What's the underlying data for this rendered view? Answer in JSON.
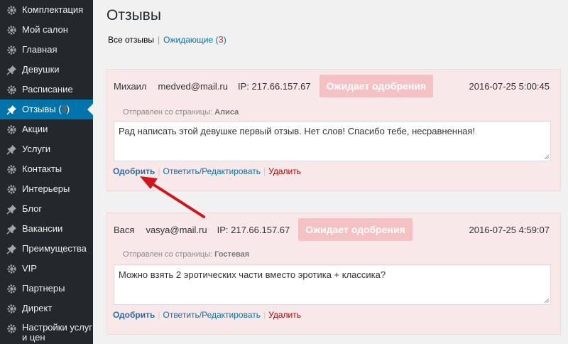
{
  "sidebar": {
    "items": [
      {
        "label": "Комплектация",
        "icon": "gear-icon"
      },
      {
        "label": "Мой салон",
        "icon": "gear-icon"
      },
      {
        "label": "Главная",
        "icon": "gear-icon"
      },
      {
        "label": "Девушки",
        "icon": "pin-icon"
      },
      {
        "label": "Расписание",
        "icon": "gear-icon"
      },
      {
        "label": "Отзывы (",
        "badge": "3",
        "suffix": ")",
        "icon": "pin-icon",
        "active": true
      },
      {
        "label": "Акции",
        "icon": "gear-icon"
      },
      {
        "label": "Услуги",
        "icon": "pin-icon"
      },
      {
        "label": "Контакты",
        "icon": "gear-icon"
      },
      {
        "label": "Интерьеры",
        "icon": "gear-icon"
      },
      {
        "label": "Блог",
        "icon": "pin-icon"
      },
      {
        "label": "Вакансии",
        "icon": "pin-icon"
      },
      {
        "label": "Преимущества",
        "icon": "pin-icon"
      },
      {
        "label": "VIP",
        "icon": "gear-icon"
      },
      {
        "label": "Партнеры",
        "icon": "gear-icon"
      },
      {
        "label": "Директ",
        "icon": "gear-icon"
      },
      {
        "label": "Настройки услуг и цен",
        "icon": "gear-icon"
      }
    ]
  },
  "page": {
    "title": "Отзывы"
  },
  "filters": {
    "all_label": "Все отзывы",
    "separator": "|",
    "pending_label": "Ожидающие (",
    "pending_count": "3",
    "pending_suffix": ")"
  },
  "reviews": [
    {
      "name": "Михаил",
      "email": "medved@mail.ru",
      "ip": "IP: 217.66.157.67",
      "status": "Ожидает одобрения",
      "date": "2016-07-25 5:00:45",
      "source_prefix": "Отправлен со страницы:",
      "source_page": "Алиса",
      "text": "Рад написать этой девушке первый отзыв. Нет слов! Спасибо тебе, несравненная!",
      "approve": "Одобрить",
      "edit": "Ответить/Редактировать",
      "delete": "Удалить"
    },
    {
      "name": "Вася",
      "email": "vasya@mail.ru",
      "ip": "IP: 217.66.157.67",
      "status": "Ожидает одобрения",
      "date": "2016-07-25 4:59:07",
      "source_prefix": "Отправлен со страницы:",
      "source_page": "Гостевая",
      "text": "Можно взять 2 эротических части вместо эротика + классика?",
      "approve": "Одобрить",
      "edit": "Ответить/Редактировать",
      "delete": "Удалить"
    }
  ],
  "colors": {
    "sidebar_bg": "#23282d",
    "active_bg": "#0073aa",
    "review_bg": "#f9e8ea",
    "status_bg": "#f4c2c5",
    "arrow": "#d0161c"
  }
}
